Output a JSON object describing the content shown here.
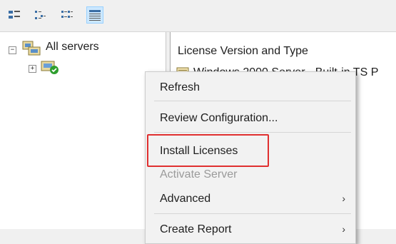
{
  "toolbar": {
    "buttons": [
      {
        "icon": "large-icons-view-icon"
      },
      {
        "icon": "small-icons-view-icon"
      },
      {
        "icon": "list-view-icon"
      },
      {
        "icon": "details-view-icon",
        "active": true
      }
    ]
  },
  "tree": {
    "root_label": "All servers",
    "child_icon": "server-licensed-icon"
  },
  "content": {
    "column_header": "License Version and Type",
    "row_partial_text": "Windows 2000 Server - Built-in TS P"
  },
  "context_menu": {
    "items": [
      {
        "label": "Refresh",
        "enabled": true
      },
      {
        "label": "Review Configuration...",
        "enabled": true
      },
      {
        "label": "Install Licenses",
        "enabled": true,
        "highlighted": true
      },
      {
        "label": "Activate Server",
        "enabled": false
      },
      {
        "label": "Advanced",
        "enabled": true,
        "submenu": true
      },
      {
        "label": "Create Report",
        "enabled": true,
        "submenu": true
      }
    ],
    "submenu_glyph": "›"
  },
  "colors": {
    "highlight_border": "#e03030",
    "active_button_bg": "#cce8ff",
    "menu_bg": "#f2f2f2"
  }
}
